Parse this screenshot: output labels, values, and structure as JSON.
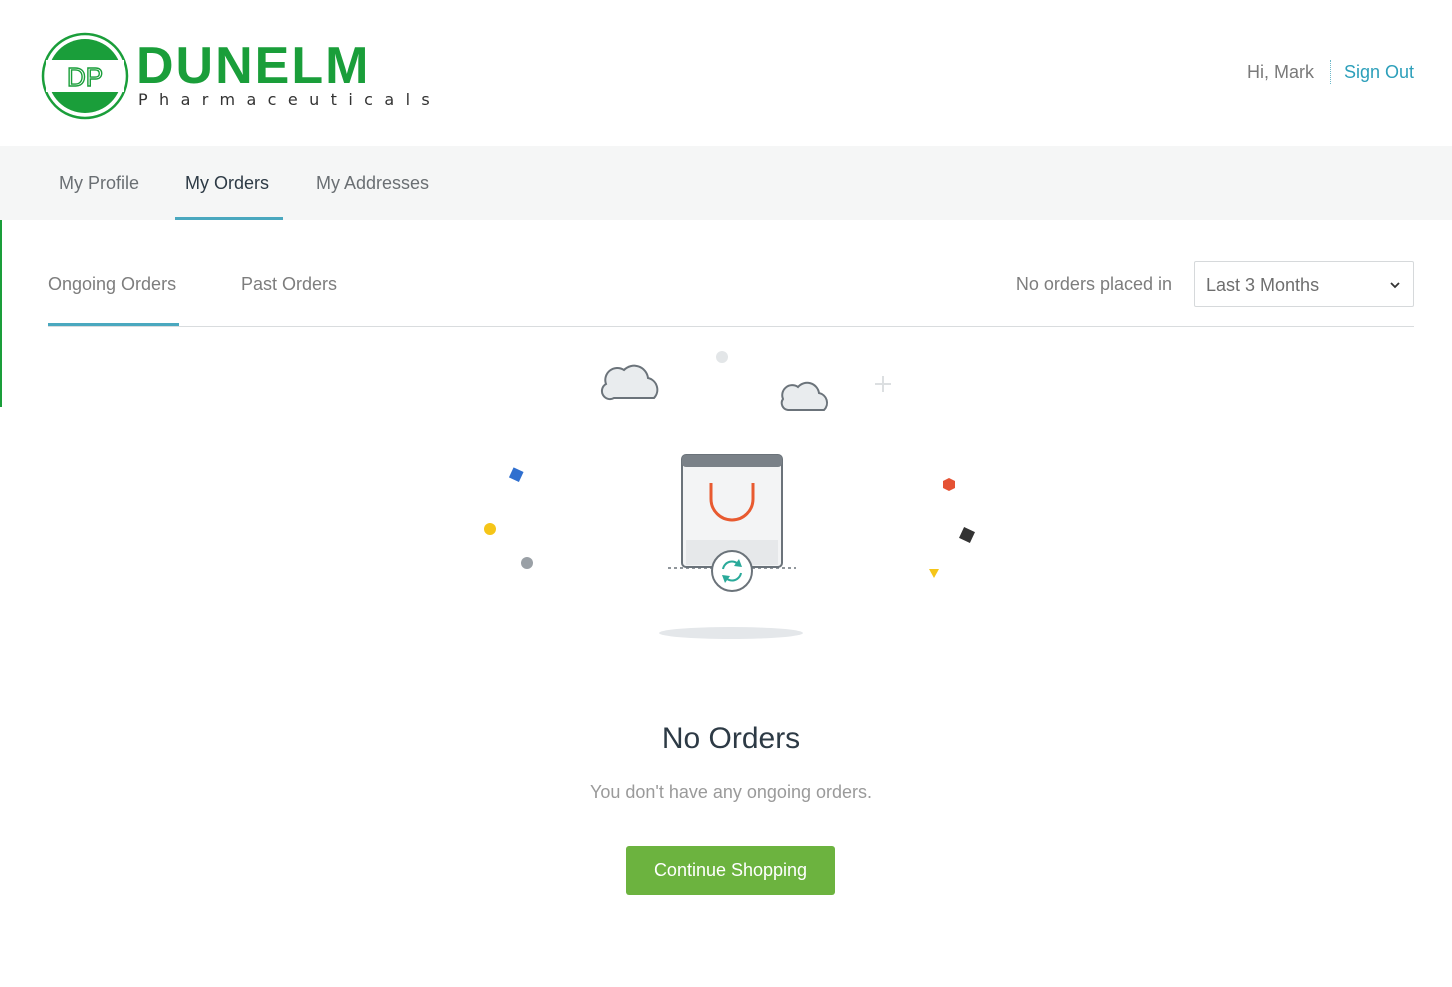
{
  "brand": {
    "monogram": "DP",
    "name": "DUNELM",
    "tagline": "Pharmaceuticals",
    "color": "#1a9e3a"
  },
  "header": {
    "greeting": "Hi, Mark",
    "signout_label": "Sign Out"
  },
  "topnav": {
    "tabs": [
      {
        "label": "My Profile",
        "active": false
      },
      {
        "label": "My Orders",
        "active": true
      },
      {
        "label": "My Addresses",
        "active": false
      }
    ]
  },
  "orders": {
    "subtabs": [
      {
        "label": "Ongoing Orders",
        "active": true
      },
      {
        "label": "Past Orders",
        "active": false
      }
    ],
    "filter_label": "No orders placed in",
    "period_selected": "Last 3 Months"
  },
  "empty_state": {
    "title": "No Orders",
    "message": "You don't have any ongoing orders.",
    "cta_label": "Continue Shopping",
    "illustration": "shopping-bag-with-refresh-icon"
  },
  "colors": {
    "accent": "#4aa8bf",
    "link": "#2c9fba",
    "cta": "#6cb33f",
    "nav_bg": "#f5f6f6"
  }
}
